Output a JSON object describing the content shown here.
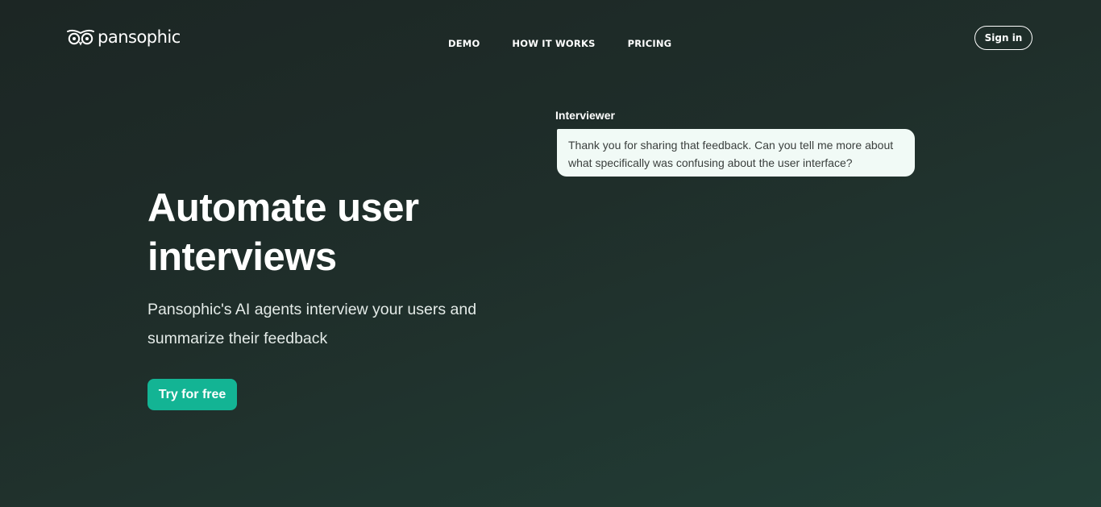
{
  "header": {
    "brand": "pansophic",
    "nav": [
      {
        "label": "DEMO"
      },
      {
        "label": "HOW IT WORKS"
      },
      {
        "label": "PRICING"
      }
    ],
    "signin_label": "Sign in"
  },
  "hero": {
    "title_line1": "Automate user",
    "title_line2": "interviews",
    "subtitle": "Pansophic's AI agents interview your users and summarize their feedback",
    "cta_label": "Try for free"
  },
  "chat": {
    "speaker": "Interviewer",
    "message": "Thank you for sharing that feedback. Can you tell me more about what specifically was confusing about the user interface?"
  },
  "colors": {
    "accent": "#13b494",
    "bubble_bg": "#f1faf6",
    "background": "#1f2e2a"
  },
  "icons": {
    "logo": "owl-eyes-icon"
  }
}
